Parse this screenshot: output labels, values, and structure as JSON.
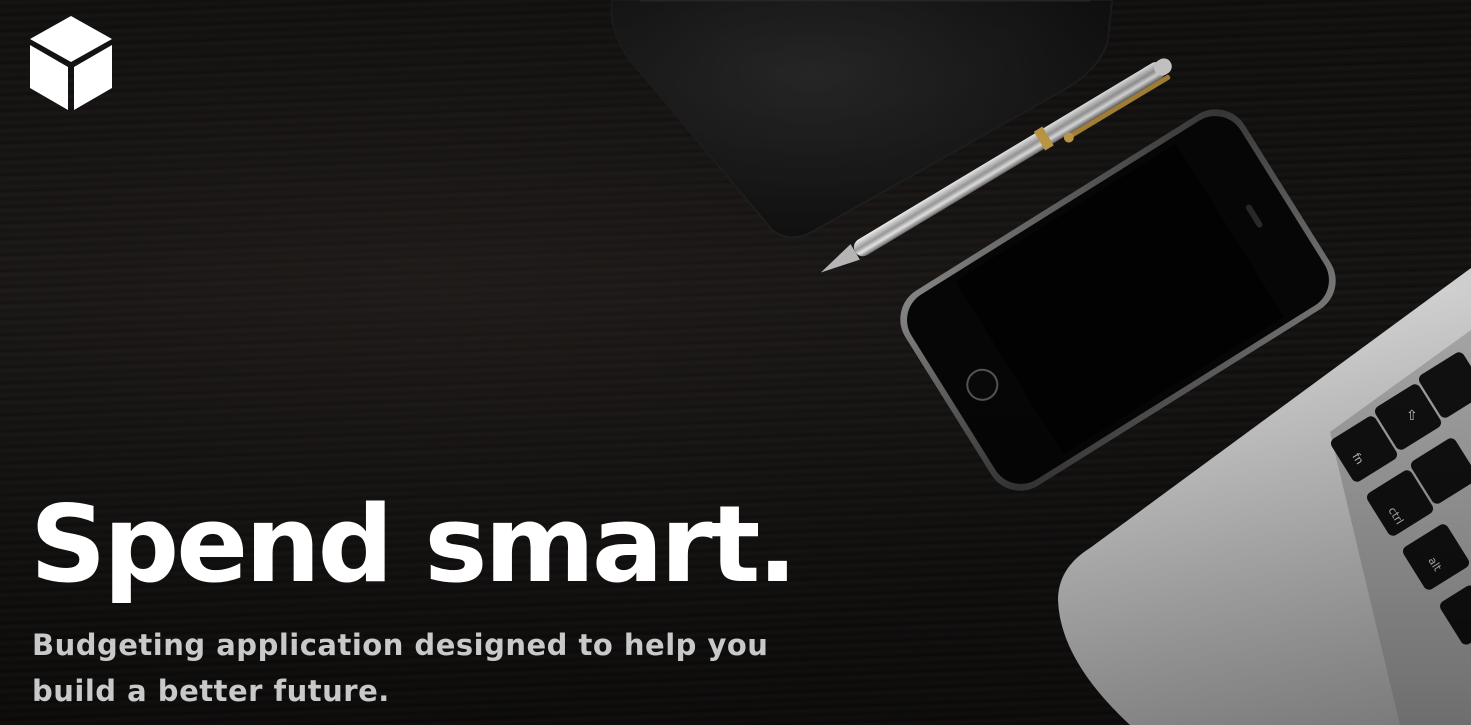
{
  "hero": {
    "headline": "Spend smart.",
    "subline_1": "Budgeting application designed to help you",
    "subline_2": "build a better future."
  },
  "logo": {
    "icon": "cube-icon",
    "color": "#ffffff"
  },
  "scene": {
    "objects": [
      "notebook",
      "pen",
      "smartphone",
      "laptop"
    ],
    "keyboard_keys": [
      "fn",
      "ctrl",
      "⇧",
      "⇧",
      "alt",
      "cmd"
    ],
    "colors": {
      "desk": "#121110",
      "laptop": "#d6d6d6",
      "phone": "#050505",
      "text": "#ffffff",
      "subtext": "#c9c9c9"
    }
  }
}
